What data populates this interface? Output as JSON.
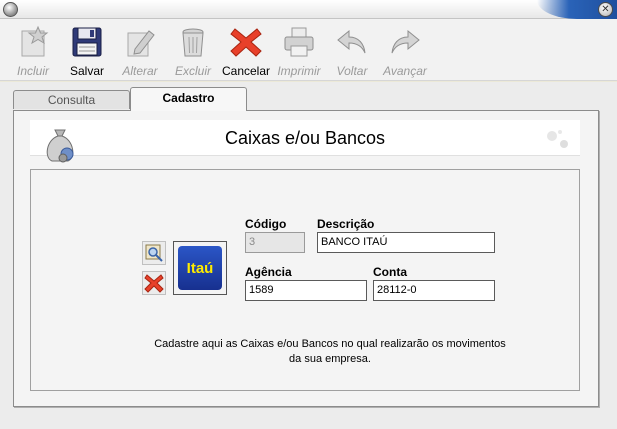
{
  "window": {
    "close_glyph": "✕"
  },
  "toolbar": {
    "buttons": [
      {
        "label": "Incluir",
        "icon": "star-add-icon",
        "enabled": false
      },
      {
        "label": "Salvar",
        "icon": "floppy-disk-icon",
        "enabled": true
      },
      {
        "label": "Alterar",
        "icon": "pencil-edit-icon",
        "enabled": false
      },
      {
        "label": "Excluir",
        "icon": "trash-can-icon",
        "enabled": false
      },
      {
        "label": "Cancelar",
        "icon": "red-x-icon",
        "enabled": true
      },
      {
        "label": "Imprimir",
        "icon": "printer-icon",
        "enabled": false
      },
      {
        "label": "Voltar",
        "icon": "back-arrow-icon",
        "enabled": false
      },
      {
        "label": "Avançar",
        "icon": "forward-arrow-icon",
        "enabled": false
      }
    ]
  },
  "tabs": [
    {
      "label": "Consulta",
      "active": false
    },
    {
      "label": "Cadastro",
      "active": true
    }
  ],
  "form": {
    "title": "Caixas e/ou Bancos",
    "logo_text": "Itaú",
    "fields": {
      "codigo": {
        "label": "Código",
        "value": "3"
      },
      "descricao": {
        "label": "Descrição",
        "value": "BANCO ITAÚ"
      },
      "agencia": {
        "label": "Agência",
        "value": "1589"
      },
      "conta": {
        "label": "Conta",
        "value": "28112-0"
      }
    },
    "hint": "Cadastre aqui as Caixas e/ou Bancos no qual realizarão os movimentos da sua empresa."
  },
  "colors": {
    "accent_blue": "#2a63b8",
    "cancel_red": "#e8402a",
    "logo_blue": "#1f3fa8",
    "logo_yellow": "#ffec00"
  }
}
